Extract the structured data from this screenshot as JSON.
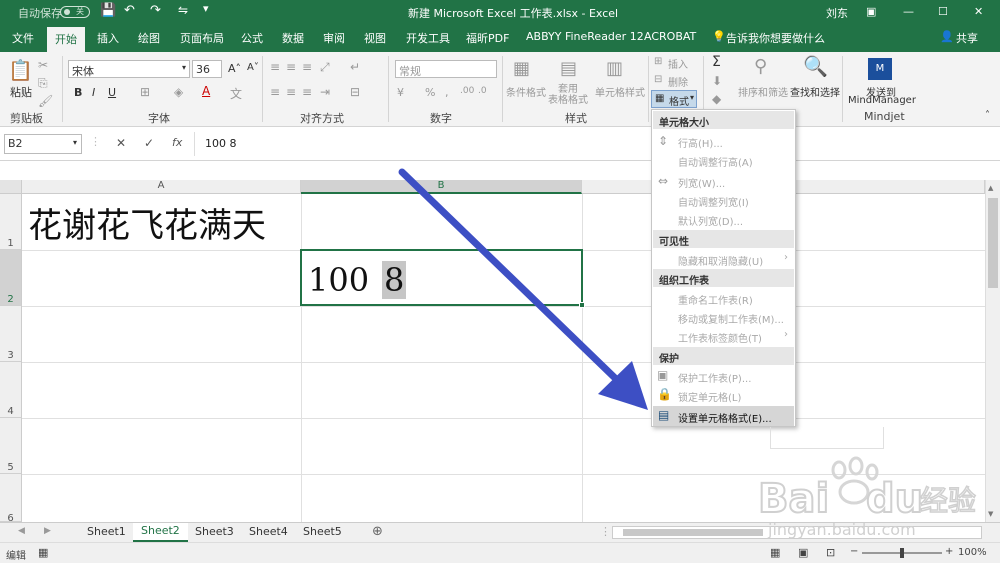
{
  "titlebar": {
    "autosave_label": "自动保存",
    "autosave_state": "关",
    "title": "新建 Microsoft Excel 工作表.xlsx  -  Excel",
    "user": "刘东"
  },
  "ribbon_tabs": [
    "文件",
    "开始",
    "插入",
    "绘图",
    "页面布局",
    "公式",
    "数据",
    "审阅",
    "视图",
    "开发工具",
    "福昕PDF",
    "ABBYY FineReader 12",
    "ACROBAT"
  ],
  "tell_me": "告诉我你想要做什么",
  "share": "共享",
  "ribbon": {
    "paste": "粘贴",
    "clipboard": "剪贴板",
    "font_name": "宋体",
    "font_size": "36",
    "font_group": "字体",
    "bold": "B",
    "italic": "I",
    "underline": "U",
    "align_group": "对齐方式",
    "number_format": "常规",
    "number_group": "数字",
    "cond_format": "条件格式",
    "table_format": "套用\n表格格式",
    "cell_style": "单元格样式",
    "style_group": "样式",
    "insert": "插入",
    "delete": "删除",
    "format": "格式",
    "sort_filter": "排序和筛选",
    "find_select": "查找和选择",
    "send_to": "发送到",
    "mindmanager": "MindManager",
    "mindjet": "Mindjet"
  },
  "formula_bar": {
    "name_box": "B2",
    "cancel": "✕",
    "enter": "✓",
    "fx": "fx",
    "value": "100 8"
  },
  "columns": [
    "A",
    "B"
  ],
  "rows": [
    "1",
    "2",
    "3",
    "4",
    "5",
    "6"
  ],
  "cells": {
    "A1": "花谢花飞花满天",
    "B2_a": "100",
    "B2_b": "8"
  },
  "format_menu": {
    "h1": "单元格大小",
    "row_height": "行高(H)...",
    "autofit_row": "自动调整行高(A)",
    "col_width": "列宽(W)...",
    "autofit_col": "自动调整列宽(I)",
    "default_width": "默认列宽(D)...",
    "h2": "可见性",
    "hide_unhide": "隐藏和取消隐藏(U)",
    "h3": "组织工作表",
    "rename": "重命名工作表(R)",
    "move_copy": "移动或复制工作表(M)...",
    "tab_color": "工作表标签颜色(T)",
    "h4": "保护",
    "protect": "保护工作表(P)...",
    "lock": "锁定单元格(L)",
    "format_cells": "设置单元格格式(E)..."
  },
  "sheets": [
    "Sheet1",
    "Sheet2",
    "Sheet3",
    "Sheet4",
    "Sheet5"
  ],
  "status": {
    "mode": "编辑",
    "zoom": "100%"
  },
  "watermark": {
    "logo": "Baidu经验",
    "url": "jingyan.baidu.com"
  },
  "colors": {
    "excel_green": "#217346",
    "arrow": "#3d4fc4"
  }
}
